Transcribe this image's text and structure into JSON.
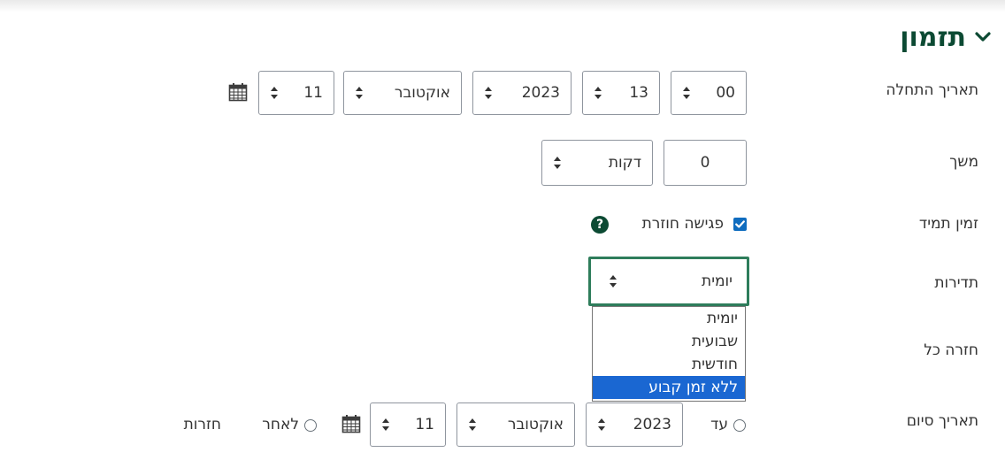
{
  "section": {
    "title": "תזמון",
    "icon": "chevron-down-icon"
  },
  "start_date": {
    "label": "תאריך התחלה",
    "day": "11",
    "month": "אוקטובר",
    "year": "2023",
    "hour": "13",
    "minute": "00",
    "calendar_icon": "calendar-icon"
  },
  "duration": {
    "label": "משך",
    "value": "0",
    "unit": "דקות"
  },
  "recurring": {
    "label": "זמין תמיד",
    "checkbox_label": "פגישה חוזרת",
    "checked": true,
    "help_icon": "?"
  },
  "frequency": {
    "label": "תדירות",
    "selected": "יומית",
    "options": [
      "יומית",
      "שבועית",
      "חודשית",
      "ללא זמן קבוע"
    ],
    "highlighted_option": "ללא זמן קבוע"
  },
  "repeat_every": {
    "label": "חזרה כל"
  },
  "end_date": {
    "label": "תאריך סיום",
    "until_label": "עד",
    "year": "2023",
    "month": "אוקטובר",
    "day": "11",
    "after_label": "לאחר",
    "occurrences_label": "חזרות"
  },
  "colors": {
    "accent": "#0c4a33",
    "focus": "#2e7d5b",
    "checkbox": "#0f6cbf",
    "highlight": "#1a67d2"
  }
}
